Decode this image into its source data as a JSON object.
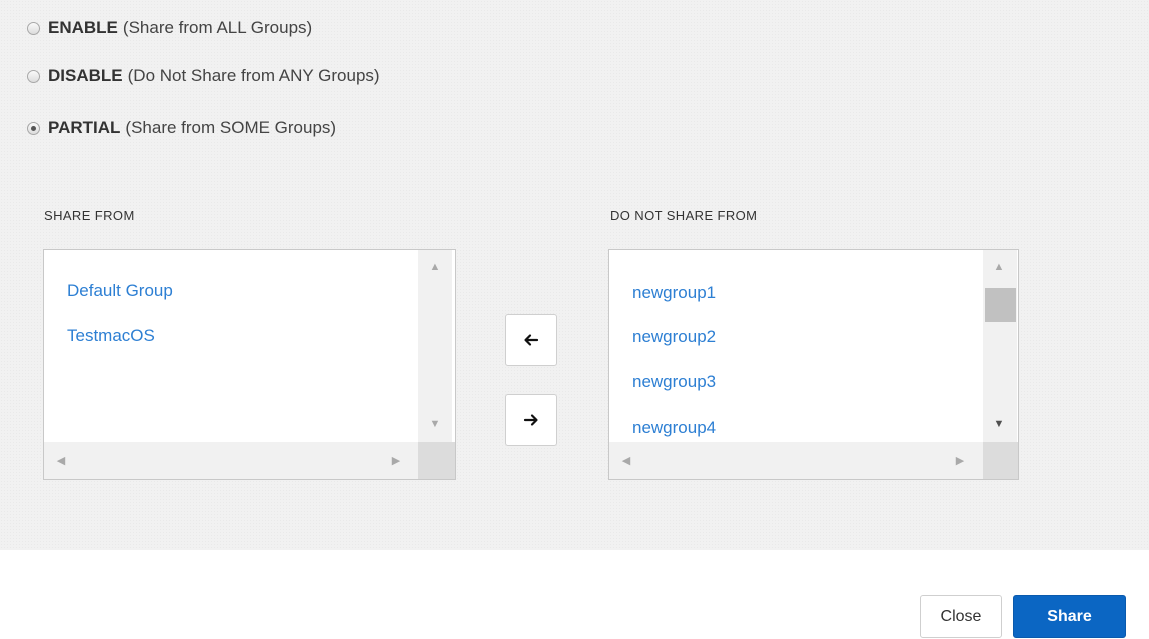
{
  "options": [
    {
      "label": "ENABLE",
      "desc": "(Share from ALL Groups)",
      "selected": false
    },
    {
      "label": "DISABLE",
      "desc": "(Do Not Share from ANY Groups)",
      "selected": false
    },
    {
      "label": "PARTIAL",
      "desc": "(Share from SOME Groups)",
      "selected": true
    }
  ],
  "share_from": {
    "label": "SHARE FROM",
    "items": [
      "Default Group",
      "TestmacOS"
    ]
  },
  "do_not_share_from": {
    "label": "DO NOT SHARE FROM",
    "items": [
      "newgroup1",
      "newgroup2",
      "newgroup3",
      "newgroup4"
    ]
  },
  "buttons": {
    "move_left_icon": "arrow-left-icon",
    "move_right_icon": "arrow-right-icon",
    "close": "Close",
    "share": "Share"
  },
  "colors": {
    "link": "#2d7fd3",
    "primary": "#0b66c3",
    "panel_bg": "#f1f1f1"
  }
}
